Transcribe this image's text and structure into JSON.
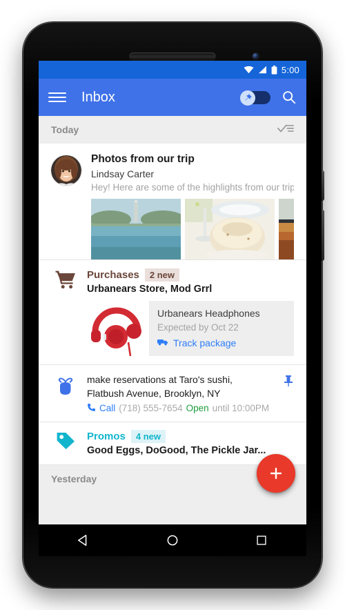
{
  "device": {
    "name": "android-phone-mockup",
    "earpiece": "earpiece-speaker",
    "front_camera": "front-camera",
    "bottom_speaker": "bottom-speaker"
  },
  "status_bar": {
    "time": "5:00",
    "icons": [
      "wifi-icon",
      "cell-signal-icon",
      "battery-icon"
    ],
    "background": "#1565d8"
  },
  "app_bar": {
    "title": "Inbox",
    "menu_icon": "hamburger-menu-icon",
    "pin_toggle": {
      "name": "pin-toggle",
      "state": "off",
      "icon": "pin-icon"
    },
    "search_icon": "search-icon",
    "background": "#3f72e8"
  },
  "sections": {
    "today": {
      "label": "Today",
      "sweep_icon": "done-all-icon"
    },
    "yesterday": {
      "label": "Yesterday",
      "sweep_icon": "done-all-icon"
    }
  },
  "cards": {
    "photos": {
      "name": "photos-from-our-trip",
      "avatar": "sender-avatar-photo",
      "subject": "Photos from our trip",
      "sender": "Lindsay Carter",
      "snippet": "Hey! Here are some of the highlights from our trip t...",
      "attachments": [
        {
          "name": "photo-washington-monument"
        },
        {
          "name": "photo-dessert-plate"
        },
        {
          "name": "photo-autumn-window"
        }
      ]
    },
    "purchases": {
      "name": "purchases-bundle",
      "icon": "shopping-cart-icon",
      "icon_color": "#6b463a",
      "title": "Purchases",
      "badge": "2 new",
      "senders": "Urbanears Store, Mod Grrl",
      "product": {
        "image": "red-headphones-photo",
        "name": "Urbanears Headphones",
        "eta": "Expected by Oct 22",
        "action_icon": "delivery-truck-icon",
        "action_label": "Track package",
        "action_color": "#2d7ef7"
      }
    },
    "reminder": {
      "name": "reminder-card",
      "icon": "finger-string-reminder-icon",
      "icon_color": "#3f72e8",
      "line1": "make reservations at Taro's sushi,",
      "line2": "Flatbush Avenue, Brooklyn, NY",
      "call_icon": "phone-icon",
      "call_label": "Call",
      "phone_number": "(718) 555-7654",
      "open_label": "Open",
      "hours_label": "until 10:00PM",
      "pin_icon": "pin-icon"
    },
    "promos": {
      "name": "promos-bundle",
      "icon": "price-tag-icon",
      "icon_color": "#13b5cd",
      "title": "Promos",
      "badge": "4 new",
      "senders": "Good Eggs, DoGood, The Pickle Jar..."
    }
  },
  "fab": {
    "name": "compose-fab",
    "icon": "plus-icon",
    "color": "#e8392a"
  },
  "nav_bar": {
    "back": "back-triangle-icon",
    "home": "home-circle-icon",
    "recents": "recents-square-icon"
  }
}
